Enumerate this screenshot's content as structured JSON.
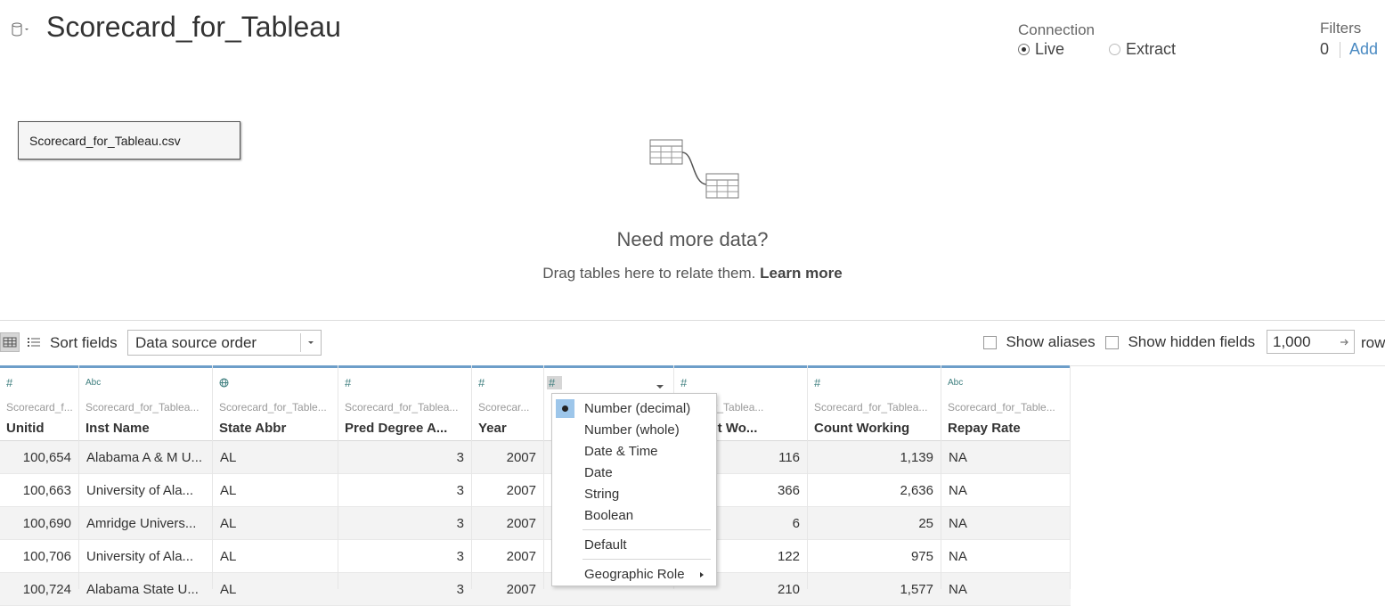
{
  "header": {
    "title": "Scorecard_for_Tableau",
    "connection_label": "Connection",
    "live_label": "Live",
    "extract_label": "Extract",
    "filters_label": "Filters",
    "filters_count": "0",
    "add_label": "Add"
  },
  "canvas": {
    "table_name": "Scorecard_for_Tableau.csv",
    "need_more": "Need more data?",
    "drag_text": "Drag tables here to relate them.",
    "learn_more": "Learn more"
  },
  "toolbar": {
    "sort_label": "Sort fields",
    "sort_value": "Data source order",
    "show_aliases": "Show aliases",
    "show_hidden": "Show hidden fields",
    "rows_value": "1,000",
    "rows_label": "row"
  },
  "columns": [
    {
      "type": "#",
      "source": "Scorecard_f...",
      "name": "Unitid"
    },
    {
      "type": "Abc",
      "source": "Scorecard_for_Tablea...",
      "name": "Inst Name"
    },
    {
      "type": "globe",
      "source": "Scorecard_for_Table...",
      "name": "State Abbr"
    },
    {
      "type": "#",
      "source": "Scorecard_for_Tablea...",
      "name": "Pred Degree A..."
    },
    {
      "type": "#",
      "source": "Scorecar...",
      "name": "Year"
    },
    {
      "type": "#",
      "source": "",
      "name": ""
    },
    {
      "type": "#",
      "source": "...rd_for_Tablea...",
      "name": "...t Not Wo..."
    },
    {
      "type": "#",
      "source": "Scorecard_for_Tablea...",
      "name": "Count Working"
    },
    {
      "type": "Abc",
      "source": "Scorecard_for_Table...",
      "name": "Repay Rate"
    }
  ],
  "rows": [
    [
      "100,654",
      "Alabama A & M U...",
      "AL",
      "3",
      "2007",
      "",
      "116",
      "1,139",
      "NA"
    ],
    [
      "100,663",
      "University of Ala...",
      "AL",
      "3",
      "2007",
      "",
      "366",
      "2,636",
      "NA"
    ],
    [
      "100,690",
      "Amridge Univers...",
      "AL",
      "3",
      "2007",
      "",
      "6",
      "25",
      "NA"
    ],
    [
      "100,706",
      "University of Ala...",
      "AL",
      "3",
      "2007",
      "",
      "122",
      "975",
      "NA"
    ],
    [
      "100,724",
      "Alabama State U...",
      "AL",
      "3",
      "2007",
      "",
      "210",
      "1,577",
      "NA"
    ]
  ],
  "type_menu": {
    "items": [
      "Number (decimal)",
      "Number (whole)",
      "Date & Time",
      "Date",
      "String",
      "Boolean"
    ],
    "selected": "Number (decimal)",
    "default_label": "Default",
    "geo_label": "Geographic Role"
  },
  "colors": {
    "accent": "#4a8ac2",
    "header_bar": "#6d9ec9",
    "menu_selected": "#9dc6ea"
  }
}
